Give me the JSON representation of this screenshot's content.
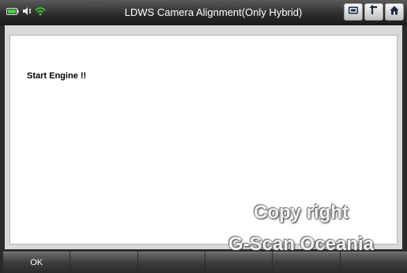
{
  "header": {
    "title": "LDWS Camera Alignment(Only Hybrid)",
    "status_icons": [
      "battery-icon",
      "speaker-icon",
      "wifi-icon"
    ],
    "nav_buttons": [
      "screenshot-icon",
      "back-icon",
      "home-icon"
    ]
  },
  "content": {
    "message": "Start Engine !!"
  },
  "watermark": {
    "line1": "Copy right",
    "line2": "G-Scan Oceania"
  },
  "softkeys": [
    {
      "label": "OK"
    },
    {
      "label": ""
    },
    {
      "label": ""
    },
    {
      "label": ""
    },
    {
      "label": ""
    },
    {
      "label": ""
    }
  ],
  "colors": {
    "accent_green": "#3fd33f",
    "icon_dark": "#1f2a44"
  }
}
